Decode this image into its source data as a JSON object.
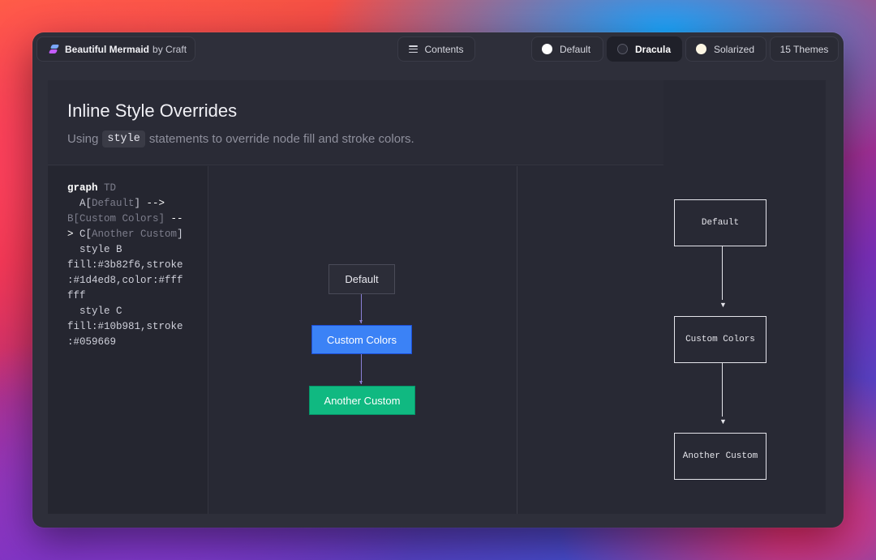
{
  "brand": {
    "name": "Beautiful Mermaid",
    "suffix": "by Craft"
  },
  "toolbar": {
    "contents_label": "Contents"
  },
  "themes": [
    {
      "label": "Default",
      "dot_color": "#ffffff",
      "selected": false
    },
    {
      "label": "Dracula",
      "dot_color": "#2a2b36",
      "selected": true
    },
    {
      "label": "Solarized",
      "dot_color": "#fdf6e3",
      "selected": false
    }
  ],
  "theme_count_label": "15 Themes",
  "section": {
    "title": "Inline Style Overrides",
    "subtitle_before": "Using",
    "subtitle_code": "style",
    "subtitle_after": "statements to override node fill and stroke colors."
  },
  "code_lines": [
    "graph TD",
    "  A[Default] -->",
    "B[Custom Colors] --",
    "> C[Another Custom]",
    "  style B",
    "fill:#3b82f6,stroke",
    ":#1d4ed8,color:#fff",
    "fff",
    "  style C",
    "fill:#10b981,stroke",
    ":#059669"
  ],
  "diagram": {
    "nodes": [
      {
        "id": "A",
        "label": "Default"
      },
      {
        "id": "B",
        "label": "Custom Colors",
        "fill": "#3b82f6",
        "stroke": "#1d4ed8",
        "color": "#ffffff"
      },
      {
        "id": "C",
        "label": "Another Custom",
        "fill": "#10b981",
        "stroke": "#059669"
      }
    ]
  },
  "ascii_diagram": {
    "nodes": [
      "Default",
      "Custom Colors",
      "Another Custom"
    ],
    "arrow_glyph": "▼"
  }
}
